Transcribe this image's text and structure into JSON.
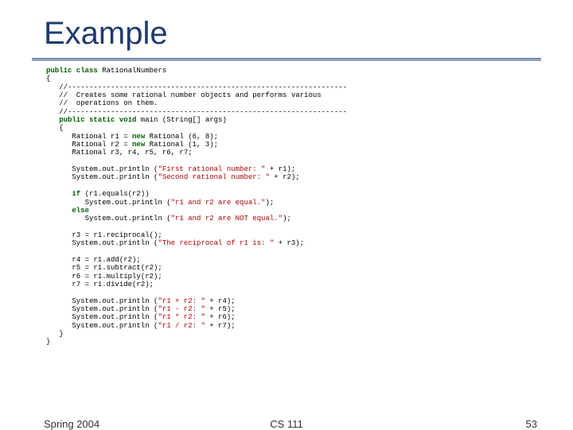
{
  "title": "Example",
  "footer": {
    "left": "Spring 2004",
    "center": "CS 111",
    "right": "53"
  },
  "code": {
    "l01a": "public",
    "l01b": " class",
    "l01c": " RationalNumbers",
    "l02": "{",
    "l03": "   //-----------------------------------------------------------------",
    "l04": "   //  Creates some rational number objects and performs various",
    "l05": "   //  operations on them.",
    "l06": "   //-----------------------------------------------------------------",
    "l07a": "   public",
    "l07b": " static",
    "l07c": " void",
    "l07d": " main (String[] args)",
    "l08": "   {",
    "l09a": "      Rational r1 = ",
    "l09b": "new",
    "l09c": " Rational (6, 8);",
    "l10a": "      Rational r2 = ",
    "l10b": "new",
    "l10c": " Rational (1, 3);",
    "l11": "      Rational r3, r4, r5, r6, r7;",
    "l12": "",
    "l13a": "      System.out.println (",
    "l13b": "\"First rational number: \"",
    "l13c": " + r1);",
    "l14a": "      System.out.println (",
    "l14b": "\"Second rational number: \"",
    "l14c": " + r2);",
    "l15": "",
    "l16a": "      if",
    "l16b": " (r1.equals(r2))",
    "l17a": "         System.out.println (",
    "l17b": "\"r1 and r2 are equal.\"",
    "l17c": ");",
    "l18a": "      else",
    "l19a": "         System.out.println (",
    "l19b": "\"r1 and r2 are NOT equal.\"",
    "l19c": ");",
    "l20": "",
    "l21": "      r3 = r1.reciprocal();",
    "l22a": "      System.out.println (",
    "l22b": "\"The reciprocal of r1 is: \"",
    "l22c": " + r3);",
    "l23": "",
    "l24": "      r4 = r1.add(r2);",
    "l25": "      r5 = r1.subtract(r2);",
    "l26": "      r6 = r1.multiply(r2);",
    "l27": "      r7 = r1.divide(r2);",
    "l28": "",
    "l29a": "      System.out.println (",
    "l29b": "\"r1 + r2: \"",
    "l29c": " + r4);",
    "l30a": "      System.out.println (",
    "l30b": "\"r1 - r2: \"",
    "l30c": " + r5);",
    "l31a": "      System.out.println (",
    "l31b": "\"r1 * r2: \"",
    "l31c": " + r6);",
    "l32a": "      System.out.println (",
    "l32b": "\"r1 / r2: \"",
    "l32c": " + r7);",
    "l33": "   }",
    "l34": "}"
  }
}
